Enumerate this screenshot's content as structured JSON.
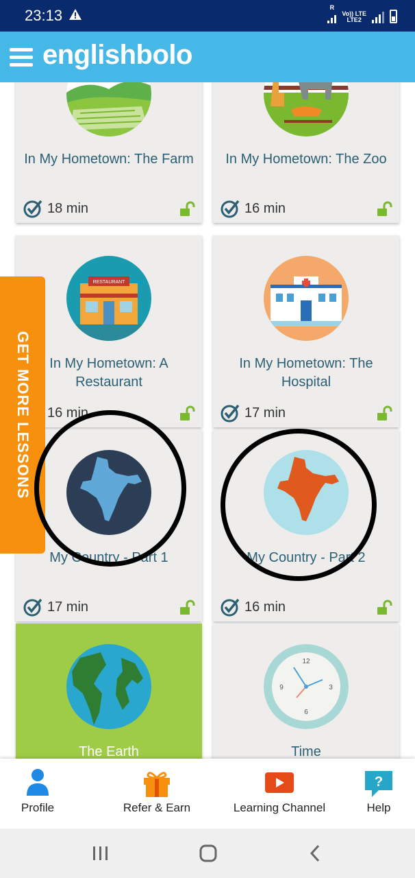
{
  "status_bar": {
    "time": "23:13",
    "sim_label_top": "R",
    "volte_label": "Vo)) LTE",
    "lte2_label": "LTE2",
    "lte_label": "LTE"
  },
  "header": {
    "app_name": "englishbolo",
    "menu_icon": "hamburger-menu-icon"
  },
  "side_tab": {
    "label": "GET MORE LESSONS"
  },
  "lessons": [
    {
      "title": "In My Hometown: The Farm",
      "duration": "18 min",
      "locked": false,
      "icon": "farm"
    },
    {
      "title": "In My Hometown: The Zoo",
      "duration": "16 min",
      "locked": false,
      "icon": "zoo"
    },
    {
      "title": "In My Hometown: A Restaurant",
      "duration": "16 min",
      "locked": false,
      "icon": "restaurant",
      "sign": "RESTAURANT"
    },
    {
      "title": "In My Hometown: The Hospital",
      "duration": "17 min",
      "locked": false,
      "icon": "hospital"
    },
    {
      "title": "My Country - Part 1",
      "duration": "17 min",
      "locked": false,
      "icon": "india-map-blue"
    },
    {
      "title": "My Country - Part 2",
      "duration": "16 min",
      "locked": false,
      "icon": "india-map-orange"
    },
    {
      "title": "The Earth",
      "duration": "",
      "icon": "globe",
      "highlight_color": "#9fcc47"
    },
    {
      "title": "Time",
      "duration": "",
      "icon": "clock",
      "clock_numbers": [
        "12",
        "3",
        "6",
        "9"
      ]
    }
  ],
  "bottom_nav": [
    {
      "label": "Profile",
      "icon": "person-icon"
    },
    {
      "label": "Refer & Earn",
      "icon": "gift-icon"
    },
    {
      "label": "Learning Channel",
      "icon": "video-play-icon"
    },
    {
      "label": "Help",
      "icon": "help-icon"
    }
  ],
  "system_nav": [
    "recent-apps-icon",
    "home-icon",
    "back-icon"
  ],
  "colors": {
    "status_bar": "#0a2a6e",
    "header": "#46b8e8",
    "side_tab": "#f7900d",
    "card": "#eeedec",
    "card_title": "#2c5f73",
    "unlock_green": "#7ab830"
  }
}
